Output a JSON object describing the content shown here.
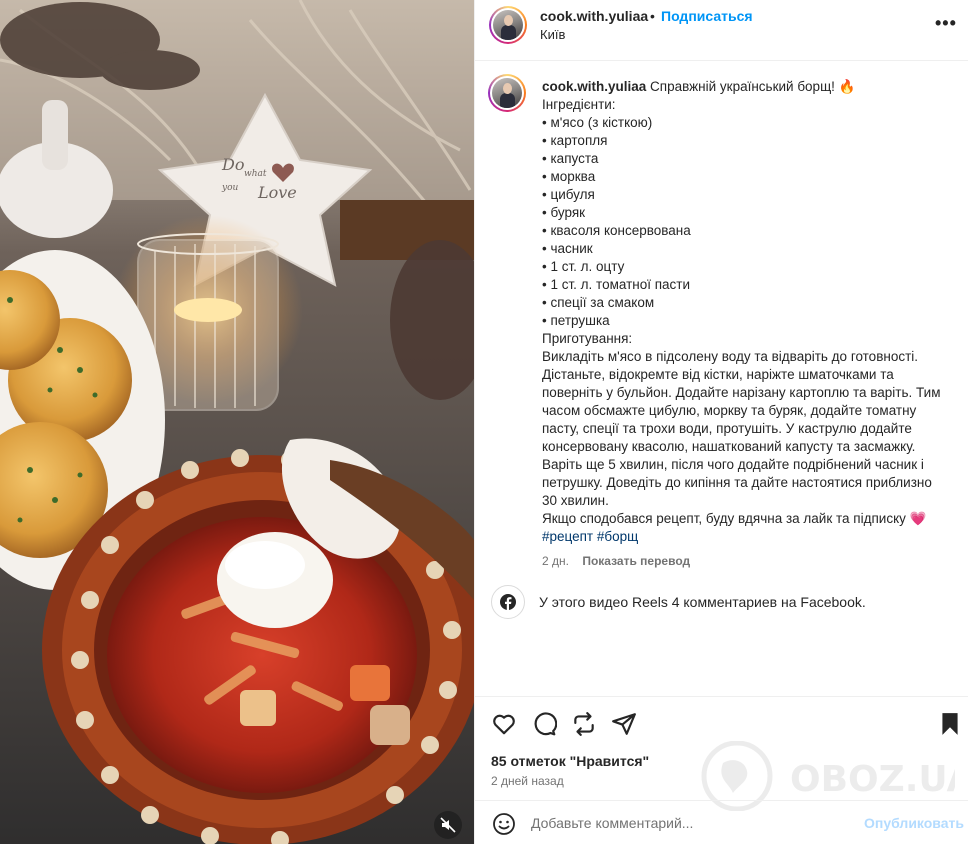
{
  "post": {
    "username": "cook.with.yuliaa",
    "separator": "•",
    "follow_label": "Подписаться",
    "location": "Київ",
    "more_label": "•••"
  },
  "caption": {
    "username": "cook.with.yuliaa",
    "title": "Справжній український борщ! 🔥",
    "lines": [
      "Інгредієнти:",
      "• м'ясо (з кісткою)",
      "• картопля",
      "• капуста",
      "• морква",
      "• цибуля",
      "• буряк",
      "• квасоля консервована",
      "• часник",
      "• 1 ст. л. оцту",
      "• 1 ст. л. томатної пасти",
      "• спеції за смаком",
      "• петрушка",
      "Приготування:"
    ],
    "method": "Викладіть м'ясо в підсолену воду та відваріть до готовності. Дістаньте, відокремте від кістки, наріжте шматочками та поверніть у бульйон. Додайте нарізану картоплю та варіть. Тим часом обсмажте цибулю, моркву та буряк, додайте томатну пасту, спеції та трохи води, протушіть. У каструлю додайте консервовану квасолю, нашаткований капусту та засмажку. Варіть ще 5 хвилин, після чого додайте подрібнений часник і петрушку. Доведіть до кипіння та дайте настоятися приблизно 30 хвилин.",
    "closing": "Якщо сподобався рецепт, буду вдячна за лайк та підписку 💗",
    "hashtags": [
      "#рецепт",
      "#борщ"
    ],
    "time": "2 дн.",
    "translate_label": "Показать перевод"
  },
  "facebook_note": "У этого видео Reels 4 комментариев на Facebook.",
  "engagement": {
    "likes": "85 отметок \"Нравится\"",
    "posted": "2 дней назад"
  },
  "comment": {
    "placeholder": "Добавьте комментарий...",
    "publish_label": "Опубликовать"
  },
  "media": {
    "star_text_line1": "Do",
    "star_text_line2": "what",
    "star_text_line3": "you",
    "star_text_line4": "Love"
  },
  "watermark": {
    "text": "OBOZ.UA"
  },
  "colors": {
    "accent_blue": "#0095f6",
    "hashtag_blue": "#00376b",
    "publish_disabled": "#b3dbff",
    "soup_red": "#b8281a"
  }
}
